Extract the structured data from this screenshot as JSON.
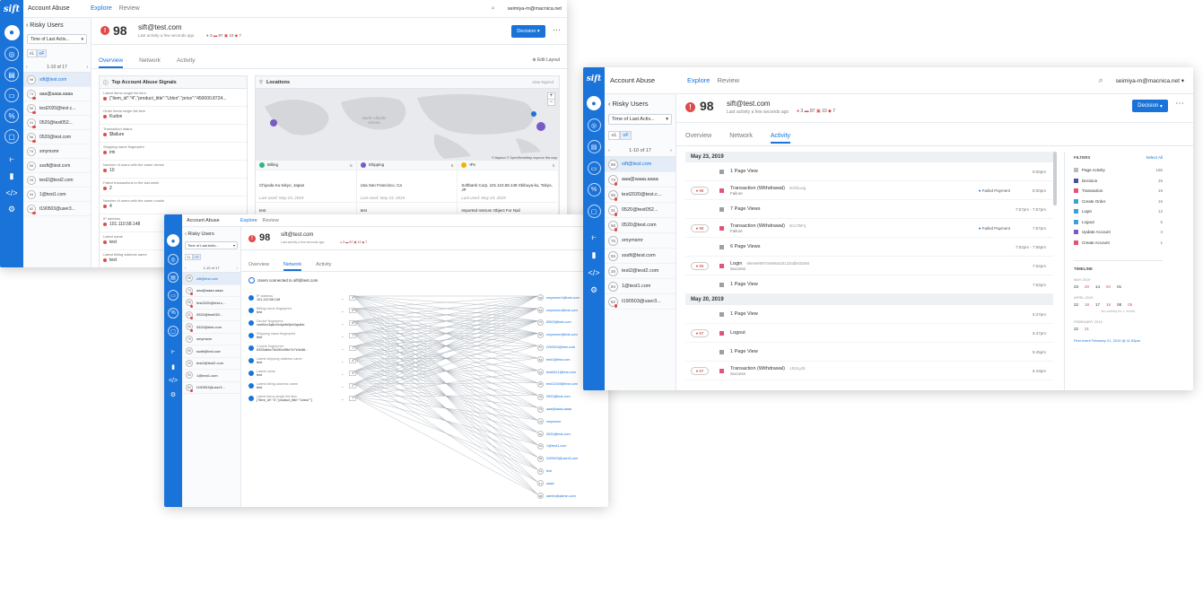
{
  "app": {
    "name": "Account Abuse",
    "logo": "sift",
    "user": "seimiya-m@macnica.net"
  },
  "nav_tabs": [
    "Explore",
    "Review"
  ],
  "risky": {
    "title": "Risky Users",
    "sort": "Time of Last Activ...",
    "toggle": [
      "≡L",
      "≡F"
    ],
    "pager": "1-10 of 17"
  },
  "users": [
    {
      "score": "98",
      "name": "sift@test.com",
      "dot": false
    },
    {
      "score": "73",
      "name": "aaa@aaaa.aaaa",
      "dot": true
    },
    {
      "score": "55",
      "name": "test2020@test.c...",
      "dot": true
    },
    {
      "score": "31",
      "name": "0520@test052...",
      "dot": true
    },
    {
      "score": "56",
      "name": "0520@test.com",
      "dot": true
    },
    {
      "score": "75",
      "name": "smymsmr",
      "dot": false
    },
    {
      "score": "55",
      "name": "sssft@test.com",
      "dot": false
    },
    {
      "score": "25",
      "name": "test2@test2.com",
      "dot": false
    },
    {
      "score": "94",
      "name": "1@test1.com",
      "dot": false
    },
    {
      "score": "82",
      "name": "t190503@user3...",
      "dot": true
    }
  ],
  "profile": {
    "score": "98",
    "email": "sift@test.com",
    "last": "Last activity a few seconds ago",
    "b1": "3",
    "b2": "87",
    "b3": "10",
    "b4": "7",
    "decision": "Decision"
  },
  "subtabs": [
    "Overview",
    "Network",
    "Activity"
  ],
  "edit_layout": "Edit Layout",
  "signals": {
    "title": "Top Account Abuse Signals",
    "items": [
      {
        "label": "Latest items single list item",
        "value": "{\"item_id\":\"4\",\"product_title\":\"Udon\",\"price\":\"450000.8724..."
      },
      {
        "label": "Order items single list item",
        "value": "Kudon"
      },
      {
        "label": "Transaction status",
        "value": "$failure"
      },
      {
        "label": "Shipping name fingerprint",
        "value": "imi"
      },
      {
        "label": "Number of users with the same device",
        "value": "10"
      },
      {
        "label": "Failed transactions in the last week",
        "value": "2"
      },
      {
        "label": "Number of users with the same cookie",
        "value": "4"
      },
      {
        "label": "IP address",
        "value": "101.110.58.148"
      },
      {
        "label": "Latest name",
        "value": "test"
      },
      {
        "label": "Latest billing address name",
        "value": "test"
      }
    ]
  },
  "locations": {
    "title": "Locations",
    "legend": "view legend",
    "credit": "© Mapbox © OpenStreetMap  Improve this map",
    "ocean": "North Atlantic Ocean",
    "cols": [
      {
        "title": "Billing",
        "count": "5",
        "place": "Chiyoda Ku-tokyo, Japan",
        "used": "Last used: May 23, 2019",
        "extra": "test"
      },
      {
        "title": "Shipping",
        "count": "6",
        "place": "Usa San Francisco, Ca",
        "used": "Last used: May 23, 2019",
        "extra": "test"
      },
      {
        "title": "IPs",
        "count": "3",
        "place": "Softbank Corp. 101.110.58.148 Shibuya-ku, Tokyo, JP",
        "used": "Last used: May 23, 2019",
        "extra": "Imported Instrum Object For Nail"
      }
    ]
  },
  "network": {
    "heading": "Users connected to sift@test.com",
    "left": [
      {
        "label": "IP address",
        "value": "101.110.58.148",
        "count": "9"
      },
      {
        "label": "Billing name fingerprint",
        "value": "test",
        "count": "6"
      },
      {
        "label": "Device fingerprint",
        "value": "voet0cv3q6n2e4ye6r9pb3qxilcb",
        "count": "8"
      },
      {
        "label": "Shipping name fingerprint",
        "value": "test",
        "count": "7"
      },
      {
        "label": "Cookie fingerprint",
        "value": "6325a6bc75c0f2c0f6e7e7e3c68...",
        "count": "7"
      },
      {
        "label": "Latest shipping address name",
        "value": "test",
        "count": "4"
      },
      {
        "label": "Latest name",
        "value": "test",
        "count": "4"
      },
      {
        "label": "Latest billing address name",
        "value": "test",
        "count": "2"
      },
      {
        "label": "Latest items single list item",
        "value": "{\"item_id\":\"4\",\"product_title\":\"Udon\"\"}",
        "count": "7"
      }
    ],
    "right": [
      {
        "s": "45",
        "n": "smymsmr1@test.com"
      },
      {
        "s": "54",
        "n": "smymsmr@test.com"
      },
      {
        "s": "72",
        "n": "t0503@test.com"
      },
      {
        "s": "56",
        "n": "smymsmr@test.com"
      },
      {
        "s": "57",
        "n": "t190520@test.com"
      },
      {
        "s": "62",
        "n": "test1@test.com"
      },
      {
        "s": "91",
        "n": "test0521@test.com"
      },
      {
        "s": "26",
        "n": "test12345@test.com"
      },
      {
        "s": "34",
        "n": "0520@test.com"
      },
      {
        "s": "73",
        "n": "aaa@aaaa.aaaa"
      },
      {
        "s": "75",
        "n": "smymsmr"
      },
      {
        "s": "56",
        "n": "0520@test.com"
      },
      {
        "s": "94",
        "n": "1@test1.com"
      },
      {
        "s": "82",
        "n": "t190503@user3.com"
      },
      {
        "s": "41",
        "n": "test"
      },
      {
        "s": "17",
        "n": "aaaa"
      },
      {
        "s": "88",
        "n": "admin@admin.com"
      }
    ]
  },
  "activity": {
    "groups": [
      {
        "date": "May 23, 2019",
        "events": [
          {
            "score": "",
            "name": "1 Page View",
            "sub": "",
            "tag": "",
            "status": "",
            "time": "8:00pm"
          },
          {
            "score": "98",
            "name": "Transaction (Withdrawal)",
            "sub": "Failure",
            "tag": "2C5fLuog",
            "status": "Failed Payment",
            "time": "8:00pm"
          },
          {
            "score": "",
            "name": "7 Page Views",
            "sub": "",
            "tag": "",
            "status": "",
            "time": "7:57pm - 7:57pm"
          },
          {
            "score": "98",
            "name": "Transaction (Withdrawal)",
            "sub": "Failure",
            "tag": "6Cx7t5Fq",
            "status": "Failed Payment",
            "time": "7:57pm"
          },
          {
            "score": "",
            "name": "6 Page Views",
            "sub": "",
            "tag": "",
            "status": "",
            "time": "7:52pm - 7:56pm"
          },
          {
            "score": "95",
            "name": "Login",
            "sub": "Success",
            "tag": "69e9e99970e886a816133adb932884",
            "status": "",
            "time": "7:52pm"
          },
          {
            "score": "",
            "name": "1 Page View",
            "sub": "",
            "tag": "",
            "status": "",
            "time": "7:52pm"
          }
        ]
      },
      {
        "date": "May 20, 2019",
        "events": [
          {
            "score": "",
            "name": "1 Page View",
            "sub": "",
            "tag": "",
            "status": "",
            "time": "5:47pm"
          },
          {
            "score": "97",
            "name": "Logout",
            "sub": "",
            "tag": "",
            "status": "",
            "time": "5:47pm"
          },
          {
            "score": "",
            "name": "1 Page View",
            "sub": "",
            "tag": "",
            "status": "",
            "time": "5:45pm"
          },
          {
            "score": "97",
            "name": "Transaction (Withdrawal)",
            "sub": "Success",
            "tag": "cJ02LyJb",
            "status": "",
            "time": "5:43pm"
          }
        ]
      }
    ],
    "filters": {
      "title": "FILTERS",
      "select": "Select All",
      "items": [
        {
          "name": "Page Activity",
          "count": "186",
          "color": "#b8bec6"
        },
        {
          "name": "Decision",
          "count": "25",
          "color": "#4a4f9c"
        },
        {
          "name": "Transaction",
          "count": "19",
          "color": "#e05577"
        },
        {
          "name": "Create Order",
          "count": "16",
          "color": "#3aa0d8"
        },
        {
          "name": "Login",
          "count": "12",
          "color": "#3aa0d8"
        },
        {
          "name": "Logout",
          "count": "5",
          "color": "#3aa0d8"
        },
        {
          "name": "Update Account",
          "count": "3",
          "color": "#7a5bc4"
        },
        {
          "name": "Create Account",
          "count": "1",
          "color": "#e05577"
        }
      ]
    },
    "timeline": {
      "title": "TIMELINE",
      "months": [
        {
          "m": "MAY 2019",
          "days": [
            "23",
            "20",
            "14",
            "04",
            "01"
          ]
        },
        {
          "m": "APRIL 2019",
          "days": [
            "22",
            "18",
            "17",
            "16",
            "08",
            "05"
          ],
          "note": "No activity for 1 month"
        },
        {
          "m": "FEBRUARY 2019",
          "days": [
            "22",
            "21"
          ]
        }
      ],
      "first": "First event February 21, 2019 @ 11:53pm"
    }
  },
  "colors": {
    "accent": "#1a73d9",
    "danger": "#e04a4a"
  }
}
